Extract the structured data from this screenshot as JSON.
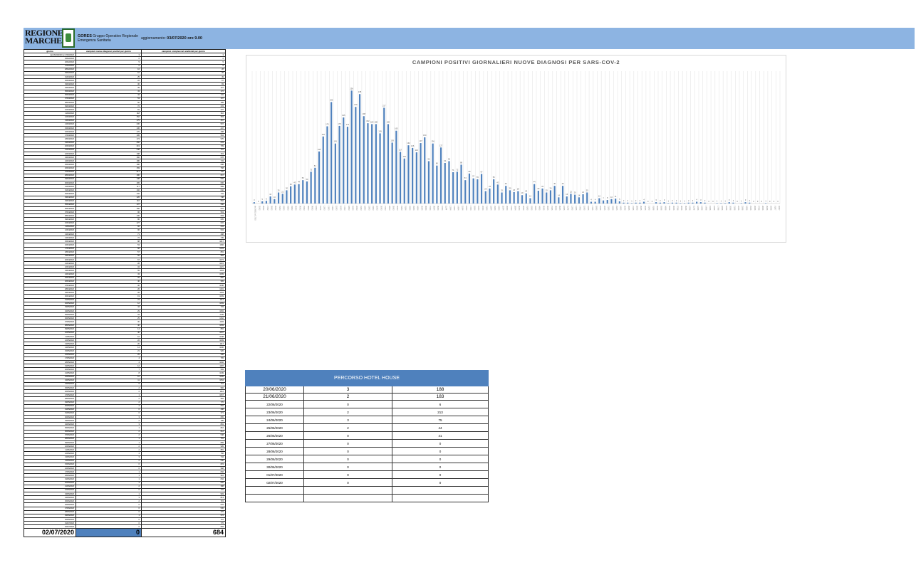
{
  "banner": {
    "logo_line1": "REGIONE",
    "logo_line2": "MARCHE",
    "gores_title": "GORES",
    "gores_sub1": "Gruppo Operativo Regionale",
    "gores_sub2": "Emergenza Sanitaria",
    "update_label": "aggiornamento:",
    "update_value": "03/07/2020 ore 9.00"
  },
  "table": {
    "headers": [
      "giorno",
      "campioni nuove diagnosi positivi per giorno",
      "campioni complessivi analizzati per giorno"
    ],
    "rows": [
      [
        "dal 26/02/2020 al 17/03/2020",
        "3",
        "3"
      ],
      [
        "25/02/2020",
        "0",
        "0"
      ],
      [
        "26/02/2020",
        "5",
        "5"
      ],
      [
        "27/02/2020",
        "6",
        "8"
      ],
      [
        "28/02/2020",
        "16",
        "28"
      ],
      [
        "29/02/2020",
        "10",
        "26"
      ],
      [
        "01/03/2020",
        "25",
        "49"
      ],
      [
        "02/03/2020",
        "22",
        "67"
      ],
      [
        "03/03/2020",
        "30",
        "83"
      ],
      [
        "04/03/2020",
        "39",
        "127"
      ],
      [
        "05/03/2020",
        "43",
        "172"
      ],
      [
        "06/03/2020",
        "44",
        "141"
      ],
      [
        "07/03/2020",
        "53",
        "197"
      ],
      [
        "08/03/2020",
        "50",
        "189"
      ],
      [
        "09/03/2020",
        "72",
        "233"
      ],
      [
        "10/03/2020",
        "81",
        "237"
      ],
      [
        "11/03/2020",
        "118",
        "310"
      ],
      [
        "12/03/2020",
        "152",
        "353"
      ],
      [
        "13/03/2020",
        "175",
        "457"
      ],
      [
        "14/03/2020",
        "230",
        "507"
      ],
      [
        "15/03/2020",
        "136",
        "447"
      ],
      [
        "16/03/2020",
        "176",
        "498"
      ],
      [
        "17/03/2020",
        "195",
        "564"
      ],
      [
        "18/03/2020",
        "174",
        "525"
      ],
      [
        "19/03/2020",
        "256",
        "633"
      ],
      [
        "20/03/2020",
        "219",
        "709"
      ],
      [
        "21/03/2020",
        "248",
        "710"
      ],
      [
        "22/03/2020",
        "198",
        "715"
      ],
      [
        "23/03/2020",
        "182",
        "678"
      ],
      [
        "24/03/2020",
        "180",
        "743"
      ],
      [
        "25/03/2020",
        "180",
        "698"
      ],
      [
        "26/03/2020",
        "159",
        "768"
      ],
      [
        "27/03/2020",
        "217",
        "732"
      ],
      [
        "28/03/2020",
        "180",
        "667"
      ],
      [
        "29/03/2020",
        "138",
        "599"
      ],
      [
        "30/03/2020",
        "165",
        "606"
      ],
      [
        "31/03/2020",
        "117",
        "589"
      ],
      [
        "01/04/2020",
        "102",
        "642"
      ],
      [
        "02/04/2020",
        "132",
        "741"
      ],
      [
        "03/04/2020",
        "126",
        "748"
      ],
      [
        "04/04/2020",
        "116",
        "662"
      ],
      [
        "05/04/2020",
        "137",
        "598"
      ],
      [
        "06/04/2020",
        "150",
        "647"
      ],
      [
        "07/04/2020",
        "96",
        "563"
      ],
      [
        "08/04/2020",
        "136",
        "693"
      ],
      [
        "09/04/2020",
        "86",
        "605"
      ],
      [
        "10/04/2020",
        "127",
        "622"
      ],
      [
        "11/04/2020",
        "92",
        "634"
      ],
      [
        "12/04/2020",
        "96",
        "534"
      ],
      [
        "13/04/2020",
        "71",
        "408"
      ],
      [
        "14/04/2020",
        "72",
        "745"
      ],
      [
        "15/04/2020",
        "88",
        "1017"
      ],
      [
        "16/04/2020",
        "53",
        "1182"
      ],
      [
        "17/04/2020",
        "68",
        "1233"
      ],
      [
        "18/04/2020",
        "57",
        "891"
      ],
      [
        "19/04/2020",
        "55",
        "984"
      ],
      [
        "20/04/2020",
        "67",
        "1074"
      ],
      [
        "21/04/2020",
        "28",
        "1015"
      ],
      [
        "22/04/2020",
        "34",
        "1121"
      ],
      [
        "23/04/2020",
        "55",
        "1163"
      ],
      [
        "24/04/2020",
        "43",
        "1099"
      ],
      [
        "25/04/2020",
        "25",
        "860"
      ],
      [
        "26/04/2020",
        "40",
        "955"
      ],
      [
        "27/04/2020",
        "30",
        "1046"
      ],
      [
        "28/04/2020",
        "26",
        "1201"
      ],
      [
        "29/04/2020",
        "28",
        "1153"
      ],
      [
        "30/04/2020",
        "19",
        "1009"
      ],
      [
        "01/05/2020",
        "23",
        "1114"
      ],
      [
        "02/05/2020",
        "12",
        "1069"
      ],
      [
        "03/05/2020",
        "44",
        "733"
      ],
      [
        "04/05/2020",
        "29",
        "1084"
      ],
      [
        "05/05/2020",
        "34",
        "1145"
      ],
      [
        "06/05/2020",
        "25",
        "1262"
      ],
      [
        "07/05/2020",
        "30",
        "1193"
      ],
      [
        "08/05/2020",
        "40",
        "1069"
      ],
      [
        "09/05/2020",
        "14",
        "884"
      ],
      [
        "10/05/2020",
        "40",
        "1097"
      ],
      [
        "11/05/2020",
        "16",
        "1048"
      ],
      [
        "12/05/2020",
        "22",
        "1009"
      ],
      [
        "13/05/2020",
        "20",
        "1117"
      ],
      [
        "14/05/2020",
        "14",
        "1030"
      ],
      [
        "15/05/2020",
        "21",
        "926"
      ],
      [
        "16/05/2020",
        "25",
        "938"
      ],
      [
        "17/05/2020",
        "4",
        "765"
      ],
      [
        "18/05/2020",
        "4",
        "1002"
      ],
      [
        "19/05/2020",
        "12",
        "1187"
      ],
      [
        "20/05/2020",
        "7",
        "959"
      ],
      [
        "21/05/2020",
        "8",
        "1049"
      ],
      [
        "22/05/2020",
        "10",
        "1095"
      ],
      [
        "23/05/2020",
        "11",
        "1054"
      ],
      [
        "24/05/2020",
        "5",
        "716"
      ],
      [
        "25/05/2020",
        "2",
        "982"
      ],
      [
        "26/05/2020",
        "2",
        "1112"
      ],
      [
        "27/05/2020",
        "1",
        "1067"
      ],
      [
        "28/05/2020",
        "2",
        "962"
      ],
      [
        "29/05/2020",
        "2",
        "770"
      ],
      [
        "30/05/2020",
        "4",
        "662"
      ],
      [
        "31/05/2020",
        "0",
        "498"
      ],
      [
        "01/06/2020",
        "0",
        "371"
      ],
      [
        "02/06/2020",
        "3",
        "655"
      ],
      [
        "03/06/2020",
        "2",
        "785"
      ],
      [
        "04/06/2020",
        "3",
        "891"
      ],
      [
        "05/06/2020",
        "1",
        "810"
      ],
      [
        "06/06/2020",
        "2",
        "612"
      ],
      [
        "07/06/2020",
        "2",
        "548"
      ],
      [
        "08/06/2020",
        "1",
        "781"
      ],
      [
        "09/06/2020",
        "1",
        "899"
      ],
      [
        "10/06/2020",
        "2",
        "935"
      ],
      [
        "11/06/2020",
        "2",
        "881"
      ],
      [
        "12/06/2020",
        "4",
        "792"
      ],
      [
        "13/06/2020",
        "3",
        "744"
      ],
      [
        "14/06/2020",
        "2",
        "540"
      ],
      [
        "15/06/2020",
        "0",
        "823"
      ],
      [
        "16/06/2020",
        "0",
        "968"
      ],
      [
        "17/06/2020",
        "1",
        "842"
      ],
      [
        "18/06/2020",
        "1",
        "910"
      ],
      [
        "19/06/2020",
        "1",
        "844"
      ],
      [
        "20/06/2020",
        "3",
        "620"
      ],
      [
        "21/06/2020",
        "2",
        "388"
      ],
      [
        "22/06/2020",
        "0",
        "722"
      ],
      [
        "23/06/2020",
        "1",
        "903"
      ],
      [
        "24/06/2020",
        "3",
        "813"
      ],
      [
        "25/06/2020",
        "2",
        "715"
      ],
      [
        "26/06/2020",
        "0",
        "676"
      ],
      [
        "27/06/2020",
        "0",
        "536"
      ],
      [
        "28/06/2020",
        "0",
        "376"
      ],
      [
        "29/06/2020",
        "1",
        "572"
      ],
      [
        "30/06/2020",
        "0",
        "710"
      ],
      [
        "01/07/2020",
        "0",
        "776"
      ],
      [
        "02/07/2020",
        "0",
        "684"
      ]
    ],
    "total_date": "02/07/2020",
    "total_positive": "0",
    "total_samples": "684"
  },
  "chart_data": {
    "type": "bar",
    "title": "CAMPIONI POSITIVI GIORNALIERI NUOVE DIAGNOSI PER SARS-COV-2",
    "xlabel": "",
    "ylabel": "",
    "ylim": [
      0,
      300
    ],
    "grid": true,
    "color": "#4f81bd",
    "categories": [
      "dal 26/02 al 17/03",
      "25/02",
      "26/02",
      "27/02",
      "28/02",
      "29/02",
      "01/03",
      "02/03",
      "03/03",
      "04/03",
      "05/03",
      "06/03",
      "07/03",
      "08/03",
      "09/03",
      "10/03",
      "11/03",
      "12/03",
      "13/03",
      "14/03",
      "15/03",
      "16/03",
      "17/03",
      "18/03",
      "19/03",
      "20/03",
      "21/03",
      "22/03",
      "23/03",
      "24/03",
      "25/03",
      "26/03",
      "27/03",
      "28/03",
      "29/03",
      "30/03",
      "31/03",
      "01/04",
      "02/04",
      "03/04",
      "04/04",
      "05/04",
      "06/04",
      "07/04",
      "08/04",
      "09/04",
      "10/04",
      "11/04",
      "12/04",
      "13/04",
      "14/04",
      "15/04",
      "16/04",
      "17/04",
      "18/04",
      "19/04",
      "20/04",
      "21/04",
      "22/04",
      "23/04",
      "24/04",
      "25/04",
      "26/04",
      "27/04",
      "28/04",
      "29/04",
      "30/04",
      "01/05",
      "02/05",
      "03/05",
      "04/05",
      "05/05",
      "06/05",
      "07/05",
      "08/05",
      "09/05",
      "10/05",
      "11/05",
      "12/05",
      "13/05",
      "14/05",
      "15/05",
      "16/05",
      "17/05",
      "18/05",
      "19/05",
      "20/05",
      "21/05",
      "22/05",
      "23/05",
      "24/05",
      "25/05",
      "26/05",
      "27/05",
      "28/05",
      "29/05",
      "30/05",
      "31/05",
      "01/06",
      "02/06",
      "03/06",
      "04/06",
      "05/06",
      "06/06",
      "07/06",
      "08/06",
      "09/06",
      "10/06",
      "11/06",
      "12/06",
      "13/06",
      "14/06",
      "15/06",
      "16/06",
      "17/06",
      "18/06",
      "19/06",
      "20/06",
      "21/06",
      "22/06",
      "23/06",
      "24/06",
      "25/06",
      "26/06",
      "27/06",
      "28/06",
      "29/06",
      "30/06",
      "01/07",
      "02/07"
    ],
    "values": [
      3,
      0,
      5,
      6,
      16,
      10,
      25,
      22,
      30,
      39,
      43,
      44,
      53,
      50,
      72,
      81,
      118,
      152,
      175,
      230,
      136,
      176,
      195,
      174,
      256,
      219,
      248,
      198,
      182,
      180,
      180,
      159,
      217,
      180,
      138,
      165,
      117,
      102,
      132,
      126,
      116,
      137,
      150,
      96,
      136,
      86,
      127,
      92,
      96,
      71,
      72,
      88,
      53,
      68,
      57,
      55,
      67,
      28,
      34,
      55,
      43,
      25,
      40,
      30,
      26,
      28,
      19,
      23,
      12,
      44,
      29,
      34,
      25,
      30,
      40,
      14,
      40,
      16,
      22,
      20,
      14,
      21,
      25,
      4,
      4,
      12,
      7,
      8,
      10,
      11,
      5,
      2,
      2,
      1,
      2,
      2,
      4,
      0,
      0,
      3,
      2,
      3,
      1,
      2,
      2,
      1,
      1,
      2,
      2,
      4,
      3,
      2,
      0,
      0,
      1,
      1,
      1,
      3,
      2,
      0,
      1,
      3,
      2,
      0,
      0,
      0,
      1,
      0,
      0,
      0
    ]
  },
  "hotel": {
    "title": "PERCORSO HOTEL HOUSE",
    "rows": [
      [
        "20/06/2020",
        "3",
        "188"
      ],
      [
        "21/06/2020",
        "2",
        "183"
      ],
      [
        "22/06/2020",
        "0",
        "6"
      ],
      [
        "23/06/2020",
        "2",
        "213"
      ],
      [
        "24/06/2020",
        "3",
        "75"
      ],
      [
        "25/06/2020",
        "2",
        "44"
      ],
      [
        "26/06/2020",
        "0",
        "41"
      ],
      [
        "27/06/2020",
        "0",
        "0"
      ],
      [
        "28/06/2020",
        "0",
        "0"
      ],
      [
        "29/06/2020",
        "0",
        "0"
      ],
      [
        "30/06/2020",
        "0",
        "0"
      ],
      [
        "01/07/2020",
        "0",
        "0"
      ],
      [
        "02/07/2020",
        "0",
        "0"
      ],
      [
        "",
        "",
        ""
      ],
      [
        "",
        "",
        ""
      ]
    ]
  }
}
